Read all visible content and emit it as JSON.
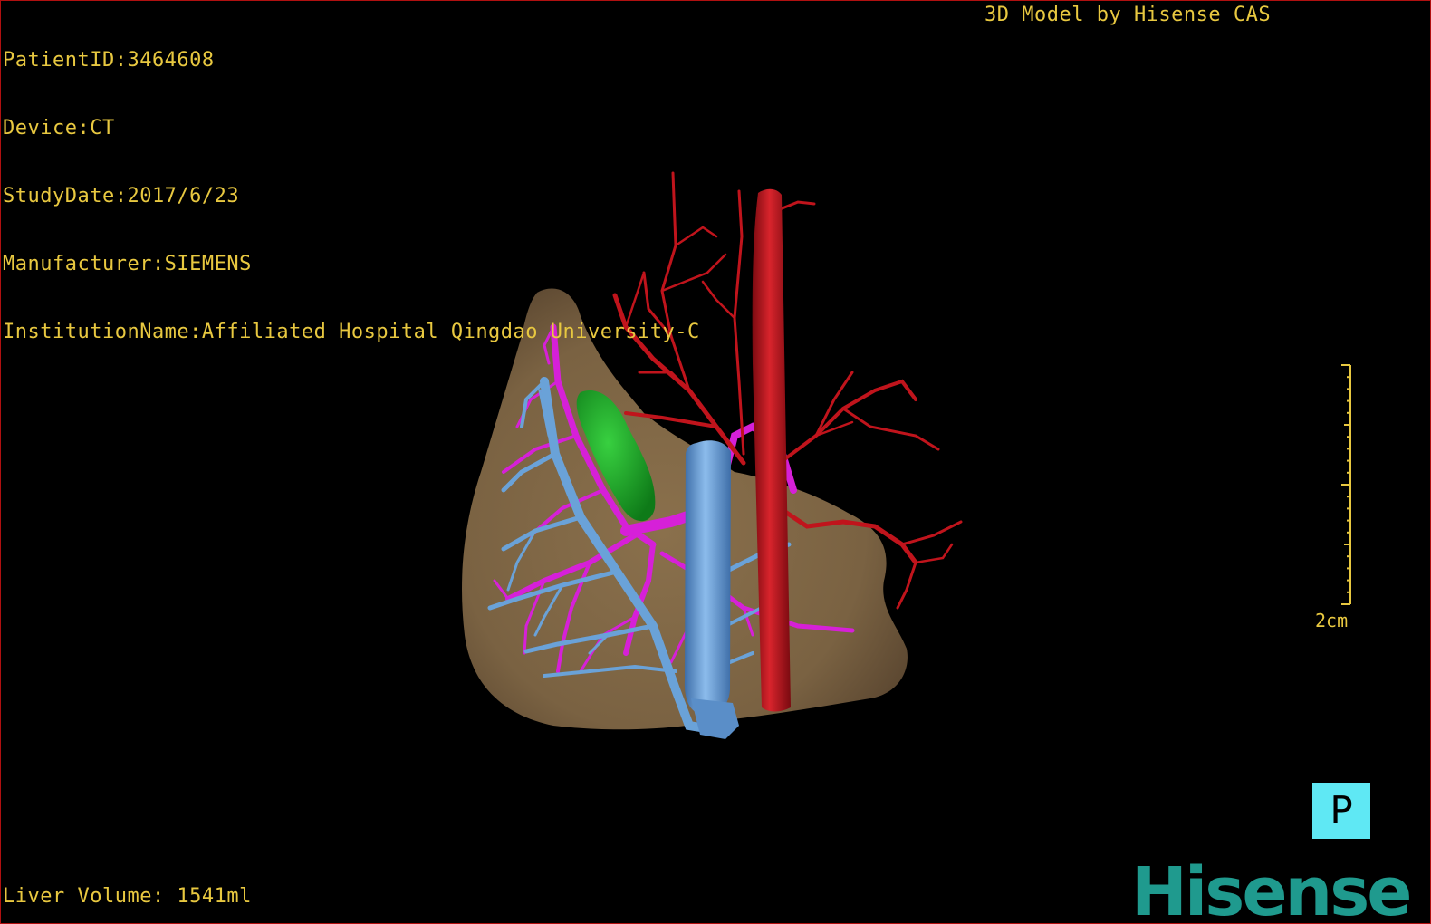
{
  "patient_info": {
    "patient_id": "PatientID:3464608",
    "device": "Device:CT",
    "study_date": "StudyDate:2017/6/23",
    "manufacturer": "Manufacturer:SIEMENS",
    "institution": "InstitutionName:Affiliated Hospital Qingdao University-C"
  },
  "model_credit": "3D Model by Hisense CAS",
  "liver_volume": "Liver Volume: 1541ml",
  "scale": {
    "label": "2cm"
  },
  "orientation_marker": "P",
  "brand": "Hisense",
  "colors": {
    "overlay_text": "#e8c840",
    "liver": "#8a704c",
    "artery": "#c0141c",
    "hepatic_vein": "#6aa2d8",
    "portal_vein": "#d620d8",
    "gallbladder": "#1aa828",
    "orientation_marker": "#5fe8f4",
    "brand": "#1f9a8e",
    "frame": "#b01010"
  }
}
